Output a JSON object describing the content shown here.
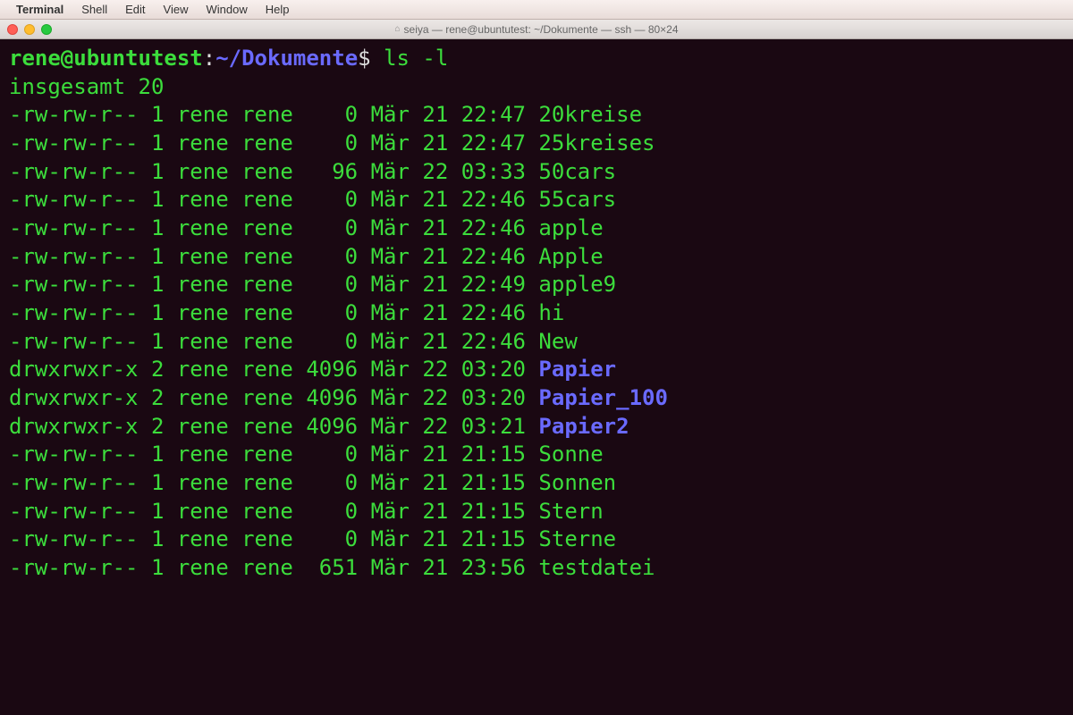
{
  "menubar": {
    "items": [
      "Terminal",
      "Shell",
      "Edit",
      "View",
      "Window",
      "Help"
    ]
  },
  "window": {
    "title": "seiya — rene@ubuntutest: ~/Dokumente — ssh — 80×24"
  },
  "prompt": {
    "user_host": "rene@ubuntutest",
    "colon": ":",
    "path": "~/Dokumente",
    "dollar": "$",
    "command": "ls -l"
  },
  "total": "insgesamt 20",
  "listing": [
    {
      "perms": "-rw-rw-r--",
      "links": "1",
      "user": "rene",
      "group": "rene",
      "size": "0",
      "month": "Mär",
      "day": "21",
      "time": "22:47",
      "name": "20kreise",
      "type": "file"
    },
    {
      "perms": "-rw-rw-r--",
      "links": "1",
      "user": "rene",
      "group": "rene",
      "size": "0",
      "month": "Mär",
      "day": "21",
      "time": "22:47",
      "name": "25kreises",
      "type": "file"
    },
    {
      "perms": "-rw-rw-r--",
      "links": "1",
      "user": "rene",
      "group": "rene",
      "size": "96",
      "month": "Mär",
      "day": "22",
      "time": "03:33",
      "name": "50cars",
      "type": "file"
    },
    {
      "perms": "-rw-rw-r--",
      "links": "1",
      "user": "rene",
      "group": "rene",
      "size": "0",
      "month": "Mär",
      "day": "21",
      "time": "22:46",
      "name": "55cars",
      "type": "file"
    },
    {
      "perms": "-rw-rw-r--",
      "links": "1",
      "user": "rene",
      "group": "rene",
      "size": "0",
      "month": "Mär",
      "day": "21",
      "time": "22:46",
      "name": "apple",
      "type": "file"
    },
    {
      "perms": "-rw-rw-r--",
      "links": "1",
      "user": "rene",
      "group": "rene",
      "size": "0",
      "month": "Mär",
      "day": "21",
      "time": "22:46",
      "name": "Apple",
      "type": "file"
    },
    {
      "perms": "-rw-rw-r--",
      "links": "1",
      "user": "rene",
      "group": "rene",
      "size": "0",
      "month": "Mär",
      "day": "21",
      "time": "22:49",
      "name": "apple9",
      "type": "file"
    },
    {
      "perms": "-rw-rw-r--",
      "links": "1",
      "user": "rene",
      "group": "rene",
      "size": "0",
      "month": "Mär",
      "day": "21",
      "time": "22:46",
      "name": "hi",
      "type": "file"
    },
    {
      "perms": "-rw-rw-r--",
      "links": "1",
      "user": "rene",
      "group": "rene",
      "size": "0",
      "month": "Mär",
      "day": "21",
      "time": "22:46",
      "name": "New",
      "type": "file"
    },
    {
      "perms": "drwxrwxr-x",
      "links": "2",
      "user": "rene",
      "group": "rene",
      "size": "4096",
      "month": "Mär",
      "day": "22",
      "time": "03:20",
      "name": "Papier",
      "type": "dir"
    },
    {
      "perms": "drwxrwxr-x",
      "links": "2",
      "user": "rene",
      "group": "rene",
      "size": "4096",
      "month": "Mär",
      "day": "22",
      "time": "03:20",
      "name": "Papier_100",
      "type": "dir"
    },
    {
      "perms": "drwxrwxr-x",
      "links": "2",
      "user": "rene",
      "group": "rene",
      "size": "4096",
      "month": "Mär",
      "day": "22",
      "time": "03:21",
      "name": "Papier2",
      "type": "dir"
    },
    {
      "perms": "-rw-rw-r--",
      "links": "1",
      "user": "rene",
      "group": "rene",
      "size": "0",
      "month": "Mär",
      "day": "21",
      "time": "21:15",
      "name": "Sonne",
      "type": "file"
    },
    {
      "perms": "-rw-rw-r--",
      "links": "1",
      "user": "rene",
      "group": "rene",
      "size": "0",
      "month": "Mär",
      "day": "21",
      "time": "21:15",
      "name": "Sonnen",
      "type": "file"
    },
    {
      "perms": "-rw-rw-r--",
      "links": "1",
      "user": "rene",
      "group": "rene",
      "size": "0",
      "month": "Mär",
      "day": "21",
      "time": "21:15",
      "name": "Stern",
      "type": "file"
    },
    {
      "perms": "-rw-rw-r--",
      "links": "1",
      "user": "rene",
      "group": "rene",
      "size": "0",
      "month": "Mär",
      "day": "21",
      "time": "21:15",
      "name": "Sterne",
      "type": "file"
    },
    {
      "perms": "-rw-rw-r--",
      "links": "1",
      "user": "rene",
      "group": "rene",
      "size": "651",
      "month": "Mär",
      "day": "21",
      "time": "23:56",
      "name": "testdatei",
      "type": "file"
    }
  ]
}
